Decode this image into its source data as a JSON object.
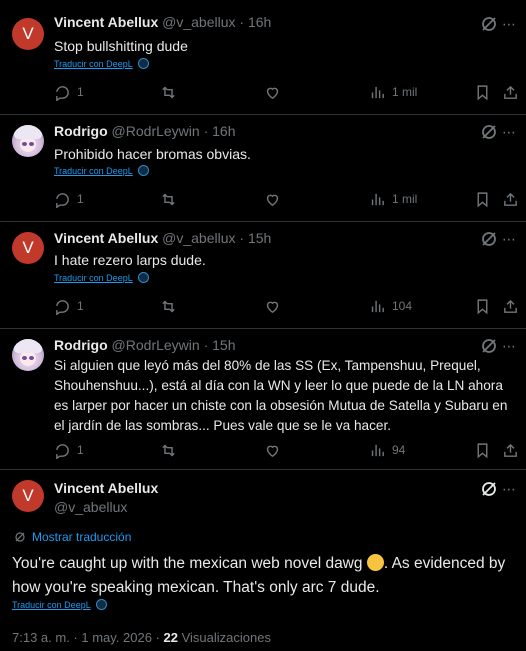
{
  "replies": [
    {
      "avatar_letter": "V",
      "name": "Vincent Abellux",
      "handle": "@v_abellux",
      "time": "16h",
      "text": "Stop bullshitting dude",
      "translate": "Traducir con DeepL",
      "stats": {
        "replies": "1",
        "retweets": "",
        "likes": "",
        "views": "1 mil"
      }
    },
    {
      "name": "Rodrigo",
      "handle": "@RodrLeywin",
      "time": "16h",
      "text": "Prohibido hacer bromas obvias.",
      "translate": "Traducir con DeepL",
      "stats": {
        "replies": "1",
        "retweets": "",
        "likes": "",
        "views": "1 mil"
      }
    },
    {
      "avatar_letter": "V",
      "name": "Vincent Abellux",
      "handle": "@v_abellux",
      "time": "15h",
      "text": "I hate rezero larps dude.",
      "translate": "Traducir con DeepL",
      "stats": {
        "replies": "1",
        "retweets": "",
        "likes": "",
        "views": "104"
      }
    },
    {
      "name": "Rodrigo",
      "handle": "@RodrLeywin",
      "time": "15h",
      "text": "Si alguien que leyó más del 80% de las SS (Ex, Tampenshuu, Prequel, Shouhenshuu...), está al día con la WN y leer lo que puede de la LN ahora es larper por hacer un chiste con la obsesión Mutua de Satella y Subaru en el jardín de las sombras... Pues vale que se le va hacer.",
      "translate": "Traducir con DeepL",
      "stats": {
        "replies": "1",
        "retweets": "",
        "likes": "",
        "views": "94"
      }
    }
  ],
  "main": {
    "avatar_letter": "V",
    "name": "Vincent Abellux",
    "handle": "@v_abellux",
    "show_translation": "Mostrar traducción",
    "text_before": "You're caught up with the mexican web novel dawg ",
    "text_after": ". As evidenced by how you're speaking mexican. That's only arc 7 dude.",
    "translate": "Traducir con DeepL",
    "timestamp": "7:13 a. m. · 1 may. 2026 · ",
    "views_count": "22",
    "views_label": " Visualizaciones"
  },
  "colors": {
    "accent": "#1d9bf0",
    "muted": "#71767b",
    "text": "#e7e9ea",
    "divider": "#2f3336"
  },
  "icons": [
    "grok-icon",
    "more-icon",
    "reply-icon",
    "retweet-icon",
    "like-icon",
    "views-icon",
    "bookmark-icon",
    "share-icon",
    "deepl-icon",
    "laughing-emoji-icon"
  ]
}
